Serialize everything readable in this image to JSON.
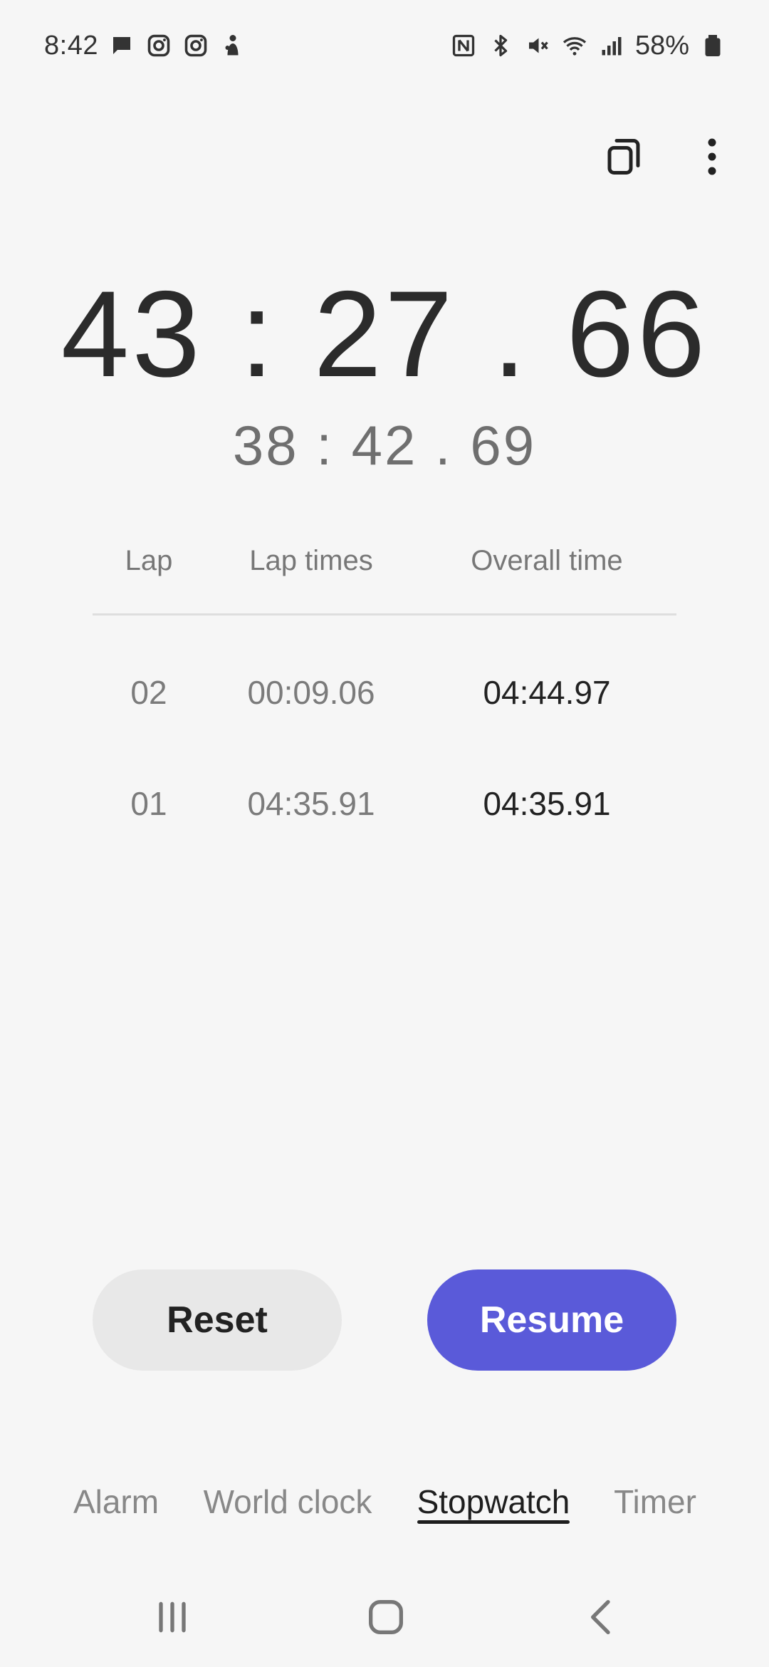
{
  "status_bar": {
    "time": "8:42",
    "battery": "58%",
    "left_icons": [
      "message-icon",
      "instagram-icon",
      "instagram-icon",
      "notification-icon"
    ],
    "right_icons": [
      "nfc-icon",
      "bluetooth-icon",
      "mute-icon",
      "wifi-icon",
      "signal-icon",
      "battery-icon"
    ]
  },
  "top_actions": [
    "popup-view-icon",
    "more-options-icon"
  ],
  "stopwatch": {
    "total_time": "43 : 27 . 66",
    "current_lap_time": "38 : 42 . 69"
  },
  "laps_table": {
    "headers": {
      "lap": "Lap",
      "lap_times": "Lap times",
      "overall_time": "Overall time"
    },
    "rows": [
      {
        "lap": "02",
        "lap_time": "00:09.06",
        "overall": "04:44.97"
      },
      {
        "lap": "01",
        "lap_time": "04:35.91",
        "overall": "04:35.91"
      }
    ]
  },
  "buttons": {
    "reset": "Reset",
    "resume": "Resume"
  },
  "tabs": [
    {
      "label": "Alarm",
      "active": false
    },
    {
      "label": "World clock",
      "active": false
    },
    {
      "label": "Stopwatch",
      "active": true
    },
    {
      "label": "Timer",
      "active": false
    }
  ],
  "colors": {
    "accent": "#5a5ad9",
    "background": "#f6f6f6"
  },
  "nav_bar": [
    "recent-apps-icon",
    "home-icon",
    "back-icon"
  ]
}
